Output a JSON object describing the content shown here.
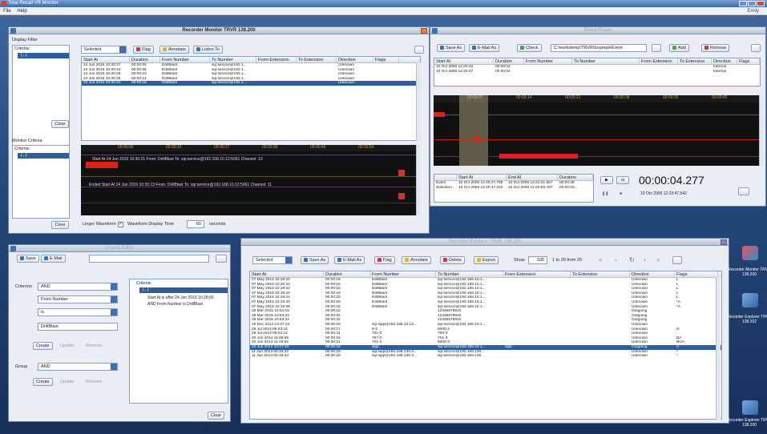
{
  "app": {
    "title": "Total Recall VR Monitor",
    "menu": [
      "File",
      "Help"
    ],
    "user": "Emily"
  },
  "recorder_monitor": {
    "title": "Recorder Monitor TRVR 138.200",
    "display_filter_label": "Display Filter",
    "criteria_label": "Criteria:",
    "criteria_item": "(...)",
    "clear_label": "Clear",
    "toolbar": {
      "selected": "Selected",
      "flag": "Flag",
      "annotate": "Annotate",
      "listen": "Listen To"
    },
    "columns": [
      "Start At",
      "Duration",
      "From Number",
      "To Number",
      "From Extension",
      "To Extension",
      "Direction",
      "Flags"
    ],
    "rows": [
      [
        "24 Jun 2015 10:30:37",
        "00:00:02",
        "DrillBlast",
        "sip:service@192.1...",
        "",
        "",
        "Unknown",
        ""
      ],
      [
        "24 Jun 2015 10:30:33",
        "00:00:06",
        "DrillBlast",
        "sip:service@192.1...",
        "",
        "",
        "Unknown",
        ""
      ],
      [
        "24 Jun 2015 10:30:29",
        "00:00:10",
        "DrillBlast",
        "sip:service@192.1...",
        "",
        "",
        "Unknown",
        ""
      ],
      [
        "24 Jun 2015 10:30:25",
        "00:00:14",
        "DrillBlast",
        "sip:service@192.1...",
        "",
        "",
        "Unknown",
        ""
      ],
      [
        "24 Jun 2015 10:30:21",
        "00:00:18",
        "DrillBlast",
        "sip:service@192.1...",
        "",
        "",
        "Unknown",
        ""
      ]
    ],
    "selected_row": 4,
    "monitor_criteria_label": "Monitor Criteria",
    "wave_ticks": [
      "00:00:00",
      "00:00:10",
      "00:00:27",
      "00:00:36",
      "00:00:46",
      "00:00:54"
    ],
    "wave_line1": "Start At 24 Jun 2015 10:30:21   From: DrillBlast   To: sip:service@192.168.10.12:5061   Channel: 13",
    "wave_line2": "Ended   Start At 24 Jun 2015 10:30:13   From: DrillBlast   To: sip:service@192.168.10.12:5061   Channel: 11",
    "linger_label": "Linger Waveform",
    "waveform_time_label": "Waveform Display Time",
    "waveform_time_value": "60",
    "seconds_label": "seconds"
  },
  "event_player": {
    "title": "Event Player",
    "toolbar": {
      "save_as": "Save As",
      "email_as": "E-Mail As",
      "check": "Check",
      "path": "C:\\workdemp\\TRVR\\ExampleEvent",
      "add": "Add",
      "remove": "Remove"
    },
    "columns": [
      "Start At",
      "Duration",
      "From Number",
      "To Number",
      "From Extension",
      "To Extension",
      "Direction",
      "Flags"
    ],
    "rows": [
      [
        "10 Oct 2006 12:20:42",
        "00:00:04",
        "",
        "",
        "",
        "",
        "Internal",
        ""
      ],
      [
        "10 Oct 2006 12:20:47",
        "00:00:04",
        "",
        "",
        "",
        "",
        "Internal",
        ""
      ]
    ],
    "ticks": [
      "00:00:07",
      "00:00:14",
      "00:00:21",
      "00:00:28",
      "00:00:35",
      "00:00:42"
    ],
    "info_cols": [
      "",
      "Start At",
      "End At",
      "Duration"
    ],
    "info_rows": [
      [
        "Event",
        "10 Oct 2006 12:20:47.765",
        "10 Oct 2006 12:21:31.557",
        "00:00:48"
      ],
      [
        "Selection",
        "10 Oct 2006 12:20:47.042",
        "10 Oct 2006 12:20:50.797",
        "00:00:03..."
      ]
    ],
    "time": "00:00:04.277",
    "time_sub": "10 Oct 2006 12:23:47.542"
  },
  "criteria_editor": {
    "title": "Criteria Editor",
    "save": "Save",
    "email": "E-Mail",
    "criterion_label": "Criterion",
    "criterion_value": "AND",
    "field_value": "From Number",
    "op_value": "is",
    "text_value": "DrillBlast",
    "create": "Create",
    "update": "Update",
    "remove": "Remove",
    "group_label": "Group",
    "group_value": "AND",
    "tree_root": "Criteria:",
    "tree_item": "(...)",
    "tree_line1": "Start At is after 24 Jun 2015 10:28:00",
    "tree_line2": "AND From Number is DrillBlast",
    "clear": "Clear"
  },
  "recorder_explorer": {
    "title": "Recorder Explorer TRVR 138.200",
    "toolbar": {
      "selected": "Selected",
      "save_as": "Save As",
      "email_as": "E-Mail As",
      "flag": "Flag",
      "annotate": "Annotate",
      "delete": "Delete",
      "export": "Export",
      "show": "Show",
      "show_value": "100",
      "range": "1 to 20 from 20"
    },
    "columns": [
      "Start At",
      "Duration",
      "From Number",
      "To Number",
      "From Extension",
      "To Extension",
      "Direction",
      "Flags"
    ],
    "rows": [
      [
        "07 May 2015 10:19:44",
        "00:00:19",
        "DrillBlast",
        "sip:service@192.168.10.1...",
        "",
        "",
        "Unknown",
        "L"
      ],
      [
        "07 May 2015 10:19:43",
        "00:00:18",
        "DrillBlast",
        "sip:service@192.168.10.1...",
        "",
        "",
        "Unknown",
        "L"
      ],
      [
        "07 May 2015 10:19:42",
        "00:00:18",
        "DrillBlast",
        "sip:service@192.168.10.1...",
        "",
        "",
        "Unknown",
        "L"
      ],
      [
        "07 May 2015 10:19:42",
        "00:00:19",
        "DrillBlast",
        "sip:service@192.168.10.1...",
        "",
        "",
        "Unknown",
        "L"
      ],
      [
        "07 May 2015 10:19:41",
        "00:00:20",
        "DrillBlast",
        "sip:service@192.168.10.1...",
        "",
        "",
        "Unknown",
        "L"
      ],
      [
        "07 May 2015 10:19:40",
        "00:00:19",
        "DrillBlast",
        "sip:service@192.168.10.1...",
        "",
        "",
        "Unknown",
        "*A"
      ],
      [
        "07 May 2015 10:19:39",
        "00:00:19",
        "DrillBlast",
        "sip:service@192.168.10.1...",
        "",
        "",
        "Unknown",
        "*A"
      ],
      [
        "26 Mar 2015 10:54:22",
        "00:00:12",
        "",
        "12345678910",
        "",
        "",
        "Outgoing",
        ""
      ],
      [
        "26 Mar 2015 10:53:22",
        "00:00:32",
        "",
        "12345678910",
        "",
        "",
        "Outgoing",
        ""
      ],
      [
        "26 Mar 2015 10:53:22",
        "00:00:32",
        "",
        "12345678910",
        "",
        "",
        "Outgoing",
        ""
      ],
      [
        "15 Dec 2014 13:47:24",
        "00:00:19",
        "sip:sipp@192.168.10.13...",
        "sip:service@192.168.10.1...",
        "",
        "",
        "Unknown",
        ""
      ],
      [
        "28 Jul 2014 09:03:44",
        "00:00:17",
        "9-2",
        "6000-2",
        "",
        "",
        "Unknown",
        "G"
      ],
      [
        "28 Jul 2014 09:02:14",
        "00:00:31",
        "701-0",
        "700-3",
        "",
        "",
        "Unknown",
        ""
      ],
      [
        "20 Jun 2014 11:48:55",
        "00:00:16",
        "787-0",
        "701-3",
        "",
        "",
        "Unknown",
        "BA"
      ],
      [
        "20 Jun 2014 11:48:52",
        "00:00:21",
        "701-0",
        "6000-3",
        "",
        "",
        "Unknown",
        "BGA"
      ],
      [
        "20 Jun 2014 10:27:43",
        "00:00:18",
        "sipp",
        "sip:service@192.168.10.1...",
        "sipp",
        "",
        "Outgoing",
        "A"
      ],
      [
        "11 Jun 2014 00:16:32",
        "00:00:19",
        "sip:sipp@192.168.130.3...",
        "sip:service@192.168.130...",
        "",
        "",
        "Unknown",
        "*"
      ],
      [
        "11 Jun 2014 00:16:24",
        "00:00:19",
        "sip:sipp@192.168.130.3...",
        "sip:service@192.168.130...",
        "",
        "",
        "Unknown",
        "*"
      ]
    ],
    "selected_row": 15
  },
  "desktop": {
    "icons": [
      {
        "label": "Recorder Monitor TRVR 138.200"
      },
      {
        "label": "Recorder Explorer TRVR 138.202"
      },
      {
        "label": "Recorder Explorer TRVR 138.200"
      }
    ]
  },
  "colors": {
    "accent": "#2f5f9a",
    "wave_red": "#ff2020",
    "wave_bg": "#111111",
    "tick": "#c9a060",
    "selection": "#f2e4b0"
  }
}
